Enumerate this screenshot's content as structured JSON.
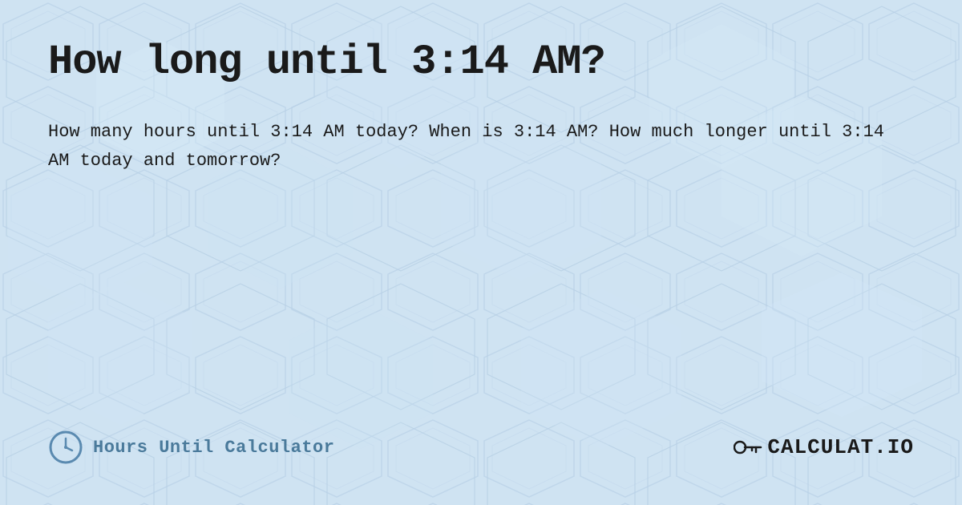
{
  "page": {
    "title": "How long until 3:14 AM?",
    "description": "How many hours until 3:14 AM today? When is 3:14 AM? How much longer until 3:14 AM today and tomorrow?",
    "footer": {
      "brand_label": "Hours Until Calculator",
      "logo_text": "CALCULAT.IO"
    },
    "background_color": "#c8dff0",
    "accent_color": "#5a8ab0"
  }
}
